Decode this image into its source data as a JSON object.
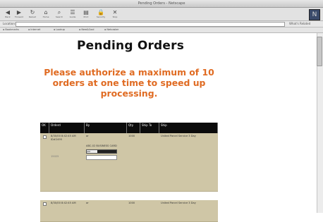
{
  "window": {
    "title": "Pending Orders - Netscape"
  },
  "toolbar": {
    "buttons": [
      {
        "name": "back",
        "label": "Back",
        "glyph": "◀"
      },
      {
        "name": "forward",
        "label": "Forward",
        "glyph": "▶"
      },
      {
        "name": "reload",
        "label": "Reload",
        "glyph": "↻"
      },
      {
        "name": "home",
        "label": "Home",
        "glyph": "⌂"
      },
      {
        "name": "search",
        "label": "Search",
        "glyph": "⌕"
      },
      {
        "name": "guide",
        "label": "Guide",
        "glyph": "☰"
      },
      {
        "name": "print",
        "label": "Print",
        "glyph": "▤"
      },
      {
        "name": "security",
        "label": "Security",
        "glyph": "🔒"
      },
      {
        "name": "stop",
        "label": "Stop",
        "glyph": "✕"
      }
    ],
    "logo_glyph": "N"
  },
  "location": {
    "label": "Location:",
    "value": "",
    "right_label": "What's Related"
  },
  "personal_bar": {
    "items": [
      "Bookmarks",
      "Internet",
      "Lookup",
      "New&Cool",
      "Netcaster"
    ]
  },
  "page": {
    "heading": "Pending Orders",
    "notice": "Please authorize a maximum of 10 orders at one time to speed up processing."
  },
  "table": {
    "columns": [
      "OK",
      "Orderd",
      "By",
      "Qty",
      "Ship To",
      "Ship"
    ],
    "rows": [
      {
        "date": "8/30/00 8:42:45 AM",
        "date_extra": "ID#2495",
        "code": "15025",
        "by": "ar",
        "by_detail": "ABC-02 BUSINESS CARD",
        "select_value": "JRD",
        "qty": "1000",
        "ship_to": "",
        "ship": "United Parcel Service 3 Day"
      },
      {
        "date": "8/30/00 8:42:45 AM",
        "date_extra": "",
        "code": "",
        "by": "ar",
        "by_detail": "",
        "select_value": "",
        "qty": "1000",
        "ship_to": "",
        "ship": "United Parcel Service 3 Day"
      }
    ]
  }
}
